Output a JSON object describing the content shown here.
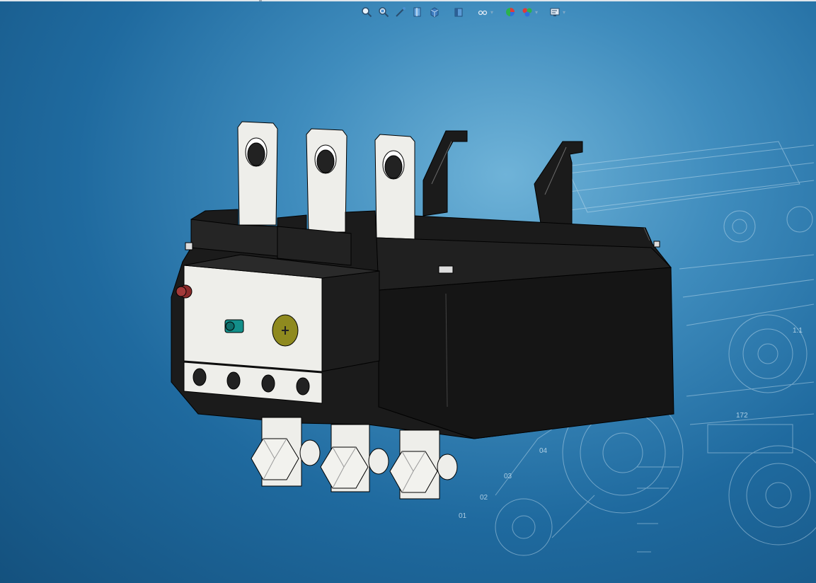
{
  "heads_up_toolbar": {
    "tools": [
      {
        "id": "zoom-to-fit",
        "icon": "zoom-to-fit-icon"
      },
      {
        "id": "zoom-to-area",
        "icon": "zoom-to-area-icon"
      },
      {
        "id": "previous-view",
        "icon": "previous-view-icon"
      },
      {
        "id": "section-view",
        "icon": "section-view-icon"
      },
      {
        "id": "view-orientation",
        "icon": "view-orientation-icon"
      },
      {
        "id": "display-style",
        "icon": "display-style-icon"
      },
      {
        "id": "hide-show-items",
        "icon": "hide-show-items-icon"
      },
      {
        "id": "edit-appearance",
        "icon": "edit-appearance-icon"
      },
      {
        "id": "apply-scene",
        "icon": "apply-scene-icon"
      },
      {
        "id": "view-settings",
        "icon": "view-settings-icon"
      }
    ]
  },
  "scene_background": {
    "top": "#6fb3d8",
    "bottom": "#14517e",
    "sketch_color": "#cfe6f4"
  },
  "model": {
    "body_color": "#1b1b1b",
    "terminal_color": "#eeeeea",
    "dial_color": "#8f8a1f",
    "reset_button_color": "#8a2a2a",
    "indicator_color": "#138f8a"
  },
  "background_sketch_labels": {
    "label_1": "04",
    "label_2": "03",
    "label_3": "02",
    "label_4": "01",
    "label_5": "1:1",
    "label_6": "172"
  }
}
